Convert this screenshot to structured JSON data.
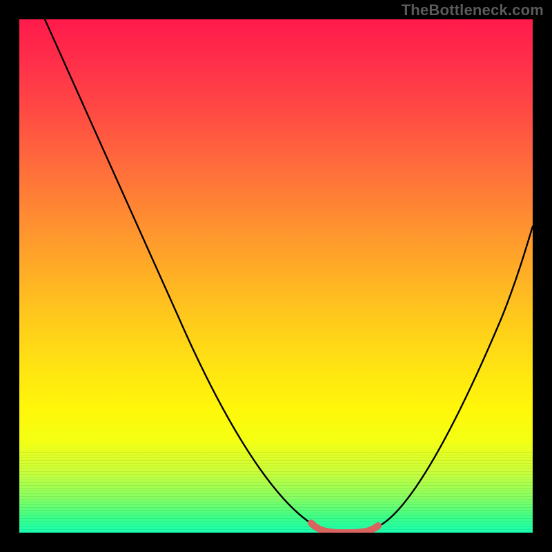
{
  "watermark": "TheBottleneck.com",
  "colors": {
    "frame": "#000000",
    "curve_stroke": "#000000",
    "highlight_stroke": "#d9645f",
    "gradient_top": "#ff1a4b",
    "gradient_bottom": "#18ffb0"
  },
  "chart_data": {
    "type": "line",
    "title": "",
    "xlabel": "",
    "ylabel": "",
    "xlim": [
      0,
      100
    ],
    "ylim": [
      0,
      100
    ],
    "grid": false,
    "legend": false,
    "series": [
      {
        "name": "bottleneck-curve",
        "x": [
          5,
          10,
          15,
          20,
          25,
          30,
          35,
          40,
          45,
          50,
          54,
          58,
          61,
          64,
          67,
          70,
          74,
          78,
          82,
          86,
          90,
          94,
          100
        ],
        "y": [
          100,
          90,
          80,
          70,
          60,
          51,
          42,
          34,
          26,
          18,
          12,
          7,
          4,
          2,
          1,
          1,
          2,
          5,
          10,
          17,
          26,
          36,
          54
        ]
      }
    ],
    "annotations": [
      {
        "name": "optimal-range-highlight",
        "x_start": 59,
        "x_end": 72,
        "y_approx": 1.5,
        "color": "#d9645f"
      }
    ]
  }
}
